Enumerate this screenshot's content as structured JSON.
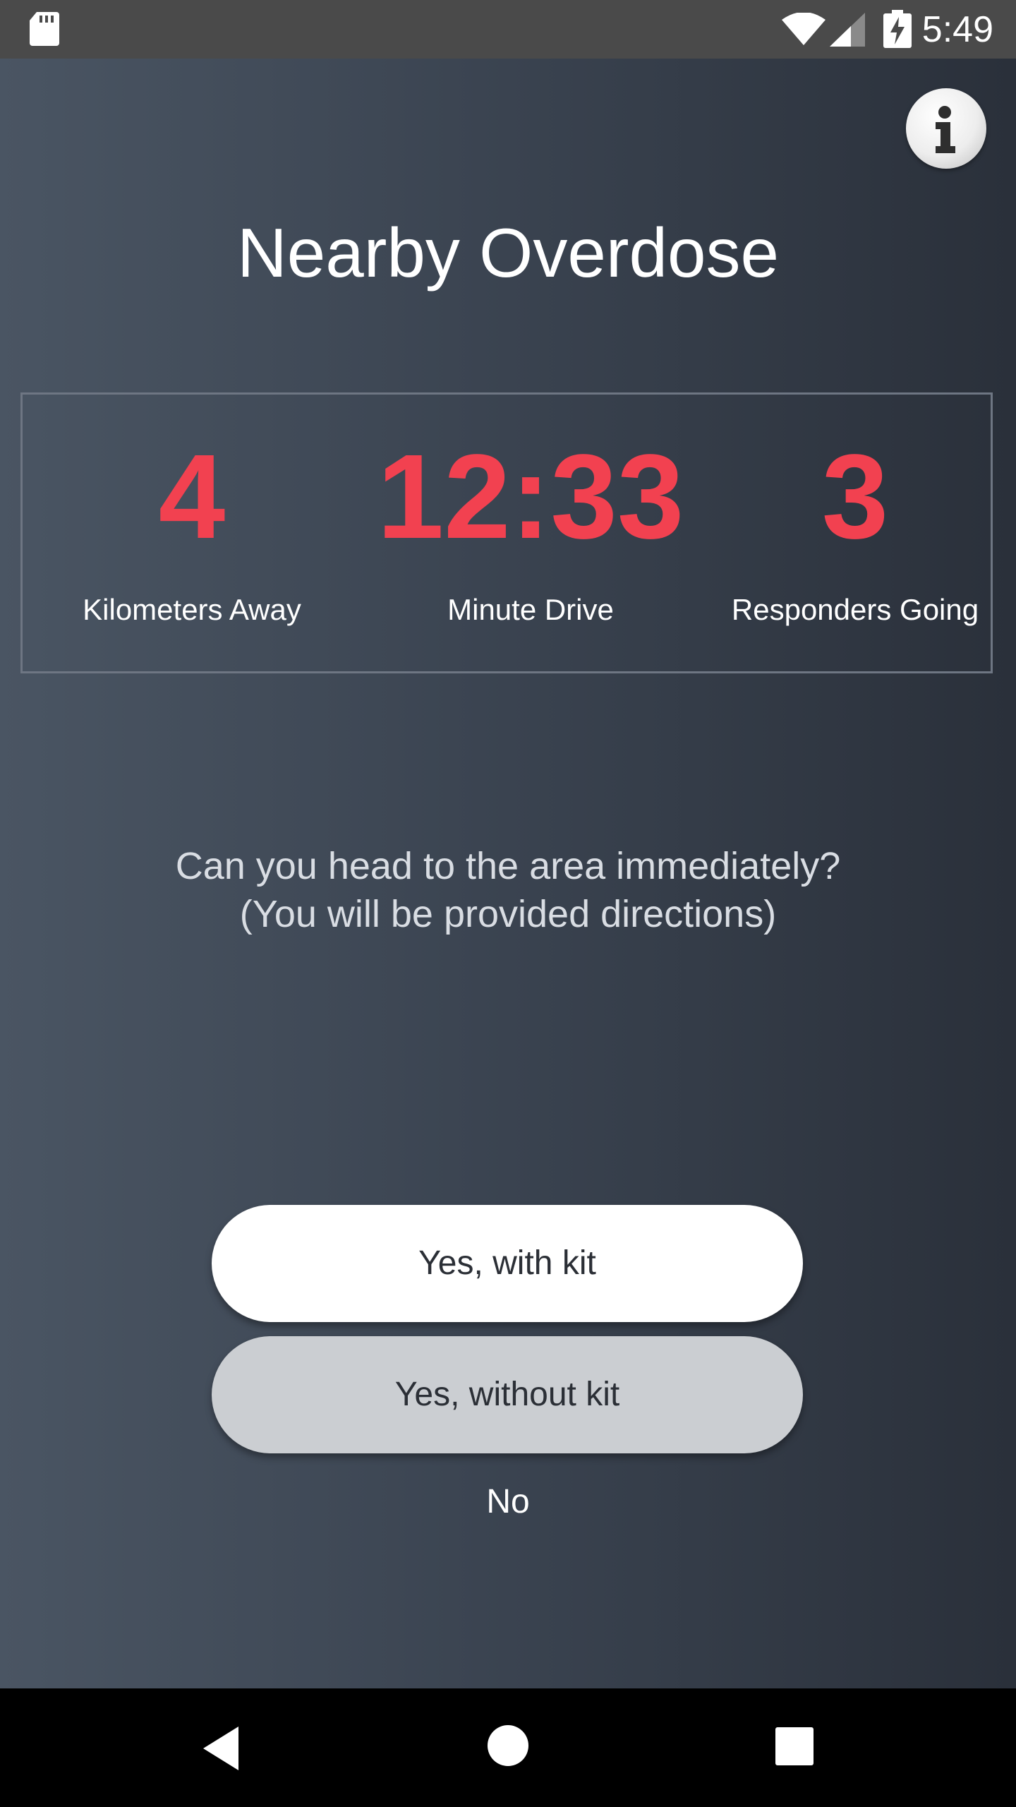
{
  "status_bar": {
    "time": "5:49"
  },
  "header": {
    "title": "Nearby Overdose"
  },
  "stats": [
    {
      "value": "4",
      "label": "Kilometers Away"
    },
    {
      "value": "12:33",
      "label": "Minute Drive"
    },
    {
      "value": "3",
      "label": "Responders Going"
    }
  ],
  "prompt": {
    "line1": "Can you head to the area immediately?",
    "line2": "(You will be provided directions)"
  },
  "actions": {
    "yes_with_kit": "Yes, with kit",
    "yes_without_kit": "Yes, without kit",
    "no": "No"
  },
  "colors": {
    "accent": "#f24150",
    "status_bar": "#4a4a4a",
    "background_dark": "#2a303a",
    "background_light": "#4a5563"
  },
  "icons": [
    "sd-card-icon",
    "wifi-icon",
    "cell-signal-icon",
    "battery-charging-icon",
    "info-icon",
    "back-icon",
    "home-icon",
    "recents-icon"
  ]
}
